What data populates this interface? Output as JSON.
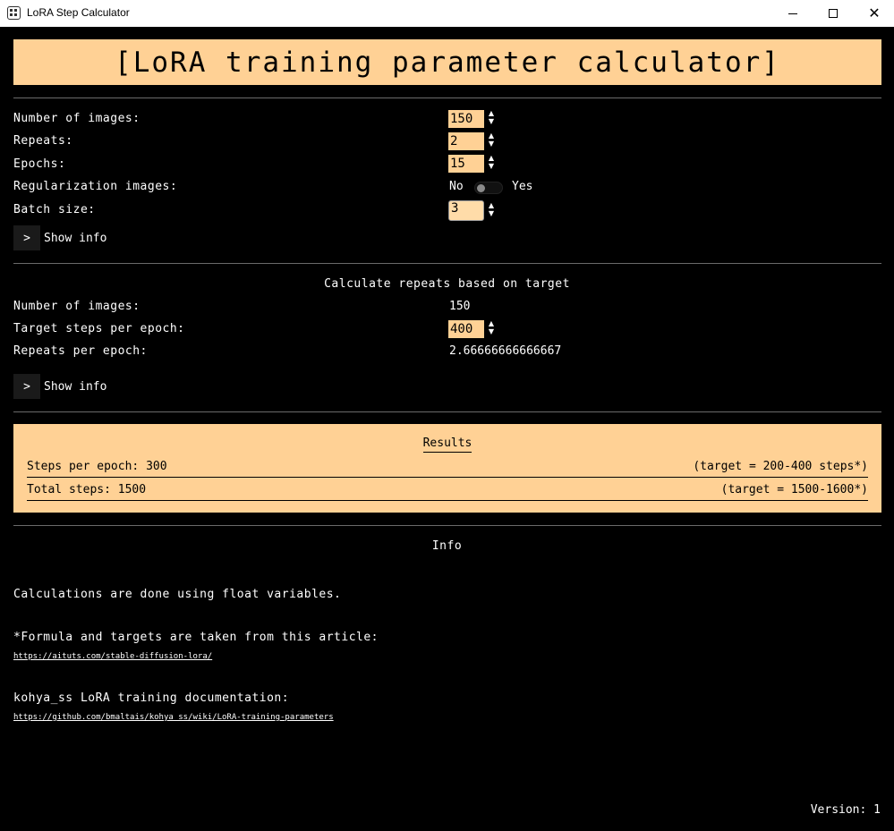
{
  "window": {
    "title": "LoRA Step Calculator",
    "minimize_icon": "minimize-icon",
    "maximize_icon": "maximize-icon",
    "close_icon": "close-icon"
  },
  "header": {
    "title": "[LoRA training parameter calculator]"
  },
  "params": {
    "images_label": "Number of images:",
    "images_value": "150",
    "repeats_label": "Repeats:",
    "repeats_value": "2",
    "epochs_label": "Epochs:",
    "epochs_value": "15",
    "reg_label": "Regularization images:",
    "reg_no": "No",
    "reg_yes": "Yes",
    "batch_label": "Batch size:",
    "batch_value": "3",
    "show_info_chev": ">",
    "show_info_label": "Show info"
  },
  "repeats_calc": {
    "title": "Calculate repeats based on target",
    "images_label": "Number of images:",
    "images_value": "150",
    "target_label": "Target steps per epoch:",
    "target_value": "400",
    "repeats_label": "Repeats per epoch:",
    "repeats_value": "2.66666666666667",
    "show_info_chev": ">",
    "show_info_label": "Show info"
  },
  "results": {
    "title": "Results",
    "steps_label": "Steps per epoch:",
    "steps_value": "300",
    "steps_target": "(target = 200-400 steps*)",
    "total_label": "Total steps:",
    "total_value": "1500",
    "total_target": "(target = 1500-1600*)"
  },
  "info": {
    "title": "Info",
    "calc_note": "Calculations are done using float variables.",
    "formula_note": "*Formula and targets are taken from this article:",
    "article_link": "https://aituts.com/stable-diffusion-lora/",
    "kohya_note": "kohya_ss LoRA training documentation:",
    "kohya_link": "https://github.com/bmaltais/kohya_ss/wiki/LoRA-training-parameters"
  },
  "footer": {
    "version": "Version: 1"
  },
  "colors": {
    "accent": "#ffd195",
    "background": "#000000",
    "text": "#ffffff"
  }
}
